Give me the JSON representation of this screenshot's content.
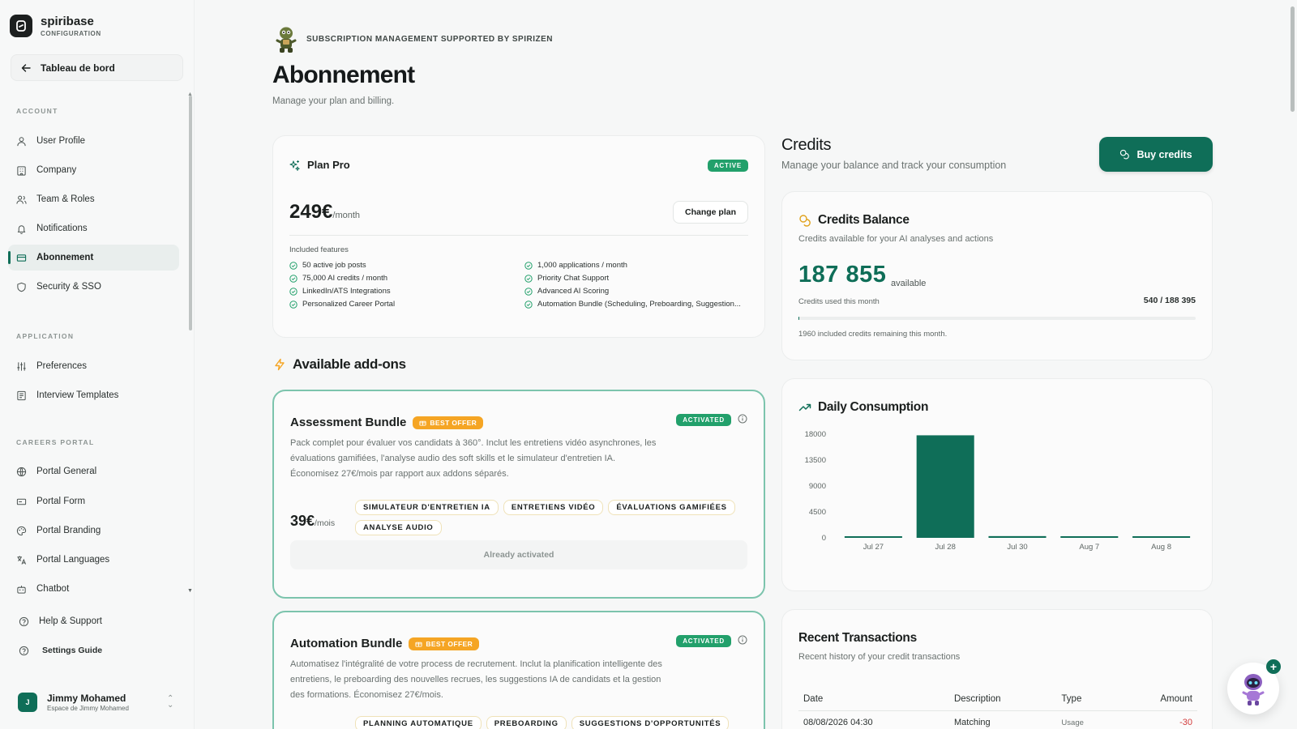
{
  "brand": {
    "name": "spiribase",
    "subtitle": "CONFIGURATION"
  },
  "back_button": {
    "label": "Tableau de bord"
  },
  "sidebar": {
    "sections": [
      {
        "title": "ACCOUNT",
        "items": [
          {
            "label": "User Profile",
            "icon": "user-icon"
          },
          {
            "label": "Company",
            "icon": "building-icon"
          },
          {
            "label": "Team & Roles",
            "icon": "users-icon"
          },
          {
            "label": "Notifications",
            "icon": "bell-icon"
          },
          {
            "label": "Abonnement",
            "icon": "credit-card-icon",
            "active": true
          },
          {
            "label": "Security & SSO",
            "icon": "shield-icon"
          }
        ]
      },
      {
        "title": "APPLICATION",
        "items": [
          {
            "label": "Preferences",
            "icon": "sliders-icon"
          },
          {
            "label": "Interview Templates",
            "icon": "template-icon"
          }
        ]
      },
      {
        "title": "CAREERS PORTAL",
        "items": [
          {
            "label": "Portal General",
            "icon": "globe-icon"
          },
          {
            "label": "Portal Form",
            "icon": "form-icon"
          },
          {
            "label": "Portal Branding",
            "icon": "palette-icon"
          },
          {
            "label": "Portal Languages",
            "icon": "languages-icon"
          },
          {
            "label": "Chatbot",
            "icon": "bot-icon"
          }
        ]
      }
    ],
    "bottom": [
      {
        "label": "Help & Support",
        "icon": "help-circle-icon"
      },
      {
        "label": "Settings Guide",
        "icon": "help-circle-icon"
      }
    ],
    "user": {
      "initial": "J",
      "name": "Jimmy Mohamed",
      "workspace": "Espace de Jimmy Mohamed"
    }
  },
  "header": {
    "kicker": "SUBSCRIPTION MANAGEMENT SUPPORTED BY SPIRIZEN",
    "title": "Abonnement",
    "subtitle": "Manage your plan and billing."
  },
  "plan": {
    "name": "Plan Pro",
    "status": "ACTIVE",
    "price": "249€",
    "period": "/month",
    "change_label": "Change plan",
    "features_title": "Included features",
    "features": [
      "50 active job posts",
      "1,000 applications / month",
      "75,000 AI credits / month",
      "Priority Chat Support",
      "LinkedIn/ATS Integrations",
      "Advanced AI Scoring",
      "Personalized Career Portal",
      "Automation Bundle (Scheduling, Preboarding, Suggestion..."
    ]
  },
  "addons": {
    "title": "Available add-ons",
    "items": [
      {
        "name": "Assessment Bundle",
        "offer": "BEST OFFER",
        "status": "ACTIVATED",
        "description": "Pack complet pour évaluer vos candidats à 360°. Inclut les entretiens vidéo asynchrones, les évaluations gamifiées, l'analyse audio des soft skills et le simulateur d'entretien IA. Économisez 27€/mois par rapport aux addons séparés.",
        "price": "39€",
        "period": "/mois",
        "tags": [
          "SIMULATEUR D'ENTRETIEN IA",
          "ENTRETIENS VIDÉO",
          "ÉVALUATIONS GAMIFIÉES",
          "ANALYSE AUDIO"
        ],
        "action": "Already activated"
      },
      {
        "name": "Automation Bundle",
        "offer": "BEST OFFER",
        "status": "ACTIVATED",
        "description": "Automatisez l'intégralité de votre process de recrutement. Inclut la planification intelligente des entretiens, le preboarding des nouvelles recrues, les suggestions IA de candidats et la gestion des formations. Économisez 27€/mois.",
        "tags": [
          "PLANNING AUTOMATIQUE",
          "PREBOARDING",
          "SUGGESTIONS D'OPPORTUNITÉS"
        ]
      }
    ]
  },
  "credits": {
    "title": "Credits",
    "subtitle": "Manage your balance and track your consumption",
    "buy_label": "Buy credits",
    "balance": {
      "title": "Credits Balance",
      "subtitle": "Credits available for your AI analyses and actions",
      "amount": "187 855",
      "amount_suffix": "available",
      "used_label": "Credits used this month",
      "used_value": "540 / 188 395",
      "used_fraction": 0.003,
      "note": "1960 included credits remaining this month."
    },
    "daily": {
      "title": "Daily Consumption"
    },
    "transactions": {
      "title": "Recent Transactions",
      "subtitle": "Recent history of your credit transactions",
      "columns": [
        "Date",
        "Description",
        "Type",
        "Amount"
      ],
      "rows": [
        {
          "date": "08/08/2026 04:30",
          "description": "Matching",
          "type": "Usage",
          "amount": "-30"
        }
      ]
    }
  },
  "colors": {
    "accent": "#0f6e58",
    "active_badge": "#22a06b",
    "offer": "#f5a524",
    "negative": "#d23b3b"
  },
  "chart_data": {
    "type": "bar",
    "categories": [
      "Jul 27",
      "Jul 28",
      "Jul 30",
      "Aug 7",
      "Aug 8"
    ],
    "values": [
      40,
      17800,
      300,
      280,
      150
    ],
    "yticks": [
      0,
      4500,
      9000,
      13500,
      18000
    ],
    "ylim": [
      0,
      18000
    ],
    "grid": false,
    "legend": "none",
    "title": "",
    "xlabel": "",
    "ylabel": ""
  }
}
